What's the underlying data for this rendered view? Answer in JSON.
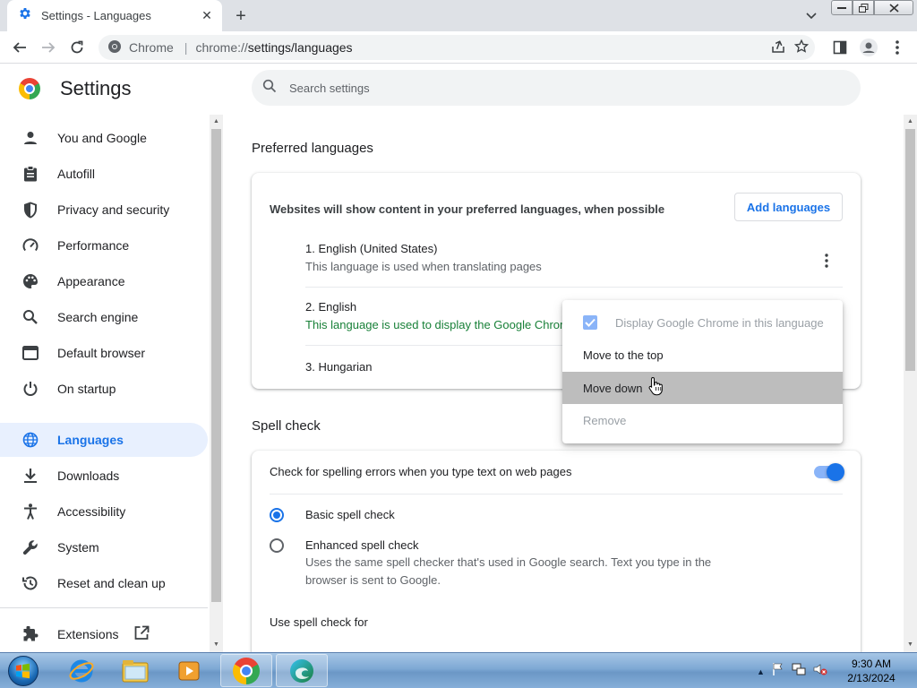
{
  "browser": {
    "tab_title": "Settings - Languages",
    "omnibox_chip": "Chrome",
    "omnibox_host": "chrome://",
    "omnibox_path": "settings/languages"
  },
  "settings": {
    "title": "Settings",
    "search_placeholder": "Search settings"
  },
  "sidebar": {
    "items": [
      {
        "label": "You and Google",
        "icon": "person-icon"
      },
      {
        "label": "Autofill",
        "icon": "clipboard-icon"
      },
      {
        "label": "Privacy and security",
        "icon": "shield-icon"
      },
      {
        "label": "Performance",
        "icon": "speedometer-icon"
      },
      {
        "label": "Appearance",
        "icon": "palette-icon"
      },
      {
        "label": "Search engine",
        "icon": "search-icon"
      },
      {
        "label": "Default browser",
        "icon": "browser-window-icon"
      },
      {
        "label": "On startup",
        "icon": "power-icon"
      },
      {
        "label": "Languages",
        "icon": "globe-icon",
        "active": true
      },
      {
        "label": "Downloads",
        "icon": "download-icon"
      },
      {
        "label": "Accessibility",
        "icon": "accessibility-icon"
      },
      {
        "label": "System",
        "icon": "wrench-icon"
      },
      {
        "label": "Reset and clean up",
        "icon": "history-icon"
      },
      {
        "label": "Extensions",
        "icon": "puzzle-icon"
      }
    ]
  },
  "preferred_languages": {
    "heading": "Preferred languages",
    "intro": "Websites will show content in your preferred languages, when possible",
    "add_button": "Add languages",
    "languages": [
      {
        "name": "1. English (United States)",
        "note": "This language is used when translating pages"
      },
      {
        "name": "2. English",
        "note": "This language is used to display the Google Chrom"
      },
      {
        "name": "3. Hungarian",
        "note": ""
      }
    ]
  },
  "context_menu": {
    "items": [
      {
        "label": "Display Google Chrome in this language",
        "checked": true,
        "disabled": true
      },
      {
        "label": "Move to the top",
        "disabled": false
      },
      {
        "label": "Move down",
        "disabled": false,
        "hover": true
      },
      {
        "label": "Remove",
        "disabled": true
      }
    ]
  },
  "spell_check": {
    "heading": "Spell check",
    "toggle_label": "Check for spelling errors when you type text on web pages",
    "toggle_on": true,
    "basic_label": "Basic spell check",
    "enhanced_label": "Enhanced spell check",
    "enhanced_desc": "Uses the same spell checker that's used in Google search. Text you type in the browser is sent to Google.",
    "selected": "basic",
    "use_for_label": "Use spell check for"
  },
  "taskbar": {
    "time": "9:30 AM",
    "date": "2/13/2024"
  },
  "colors": {
    "accent": "#1a73e8",
    "active_nav_bg": "#e8f0fe",
    "green_note": "#188038",
    "menu_hover": "#bdbdbd"
  }
}
